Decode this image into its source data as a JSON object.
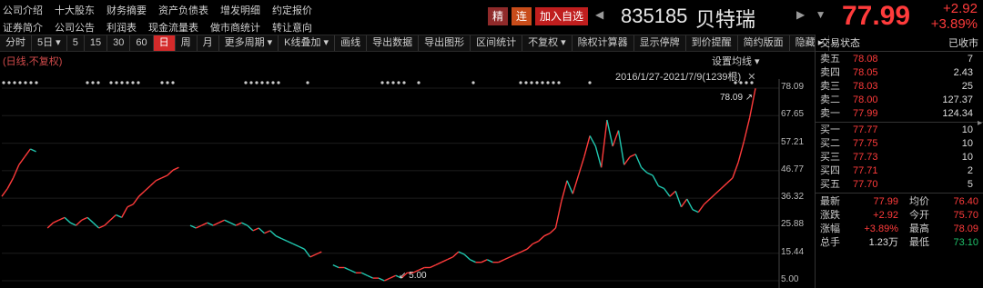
{
  "links": {
    "row1": [
      "公司介绍",
      "十大股东",
      "财务摘要",
      "资产负债表",
      "增发明细",
      "约定报价"
    ],
    "row2": [
      "证券简介",
      "公司公告",
      "利润表",
      "现金流量表",
      "做市商统计",
      "转让意向"
    ]
  },
  "title_bar": {
    "tag_jing": "精",
    "tag_lian": "连",
    "add_watchlist": "加入自选",
    "prev_icon": "◀",
    "code": "835185",
    "name": "贝特瑞",
    "next_icons": "▶ ▼",
    "price": "77.99",
    "change": "+2.92",
    "change_pct": "+3.89%"
  },
  "toolbar": {
    "items": [
      "分时",
      "5日 ▾",
      "5",
      "15",
      "30",
      "60",
      "日",
      "周",
      "月",
      "更多周期 ▾",
      "K线叠加 ▾",
      "画线",
      "导出数据",
      "导出图形",
      "区间统计",
      "不复权 ▾",
      "除权计算器",
      "显示停牌",
      "到价提醒"
    ],
    "active_index": 6,
    "right_items": [
      "简约版面",
      "隐藏 ▸"
    ]
  },
  "chart": {
    "note": "(日线,不复权)",
    "settings": "设置均线 ▾",
    "range": "2016/1/27-2021/7/9(1239根)",
    "close_icon": "✕",
    "max_label": "78.09 ↗",
    "min_label": "↙ 5.00",
    "y_ticks": [
      "78.09",
      "67.65",
      "57.21",
      "46.77",
      "36.32",
      "25.88",
      "15.44",
      "5.00"
    ]
  },
  "chart_data": {
    "type": "line",
    "title": "",
    "xlabel": "",
    "ylabel": "",
    "ylim": [
      5.0,
      78.09
    ],
    "y_ticks": [
      78.09,
      67.65,
      57.21,
      46.77,
      36.32,
      25.88,
      15.44,
      5.0
    ],
    "series": [
      {
        "values": [
          37,
          40,
          44,
          49,
          52,
          55,
          54,
          null,
          25,
          27,
          28,
          29,
          27,
          26,
          28,
          29,
          27,
          25,
          26,
          28,
          30,
          29,
          33,
          34,
          37,
          39,
          41,
          43,
          44,
          45,
          47,
          48,
          null,
          26,
          25,
          26,
          27,
          26,
          27,
          28,
          27,
          26,
          27,
          26,
          24,
          25,
          23,
          24,
          22,
          21,
          20,
          19,
          18,
          17,
          14,
          15,
          16,
          null,
          11,
          10,
          10,
          9,
          8,
          8,
          7,
          6,
          6,
          5,
          6,
          7,
          6,
          8,
          8,
          9,
          10,
          10,
          11,
          12,
          13,
          14,
          16,
          15,
          13,
          12,
          12,
          13,
          12,
          12,
          13,
          14,
          15,
          16,
          17,
          19,
          20,
          22,
          23,
          25,
          35,
          43,
          38,
          45,
          52,
          60,
          56,
          48,
          66,
          56,
          62,
          49,
          52,
          53,
          48,
          46,
          45,
          41,
          40,
          37,
          39,
          33,
          36,
          32,
          31,
          34,
          36,
          38,
          40,
          42,
          44,
          50,
          58,
          67,
          78
        ]
      }
    ],
    "max_point": 78.09,
    "min_point": 5.0,
    "date_range": "2016/1/27-2021/7/9",
    "bars": 1239
  },
  "order_book": {
    "header": "交易状态",
    "status": "已收市",
    "asks": [
      {
        "label": "卖五",
        "price": "78.08",
        "vol": "7"
      },
      {
        "label": "卖四",
        "price": "78.05",
        "vol": "2.43"
      },
      {
        "label": "卖三",
        "price": "78.03",
        "vol": "25"
      },
      {
        "label": "卖二",
        "price": "78.00",
        "vol": "127.37"
      },
      {
        "label": "卖一",
        "price": "77.99",
        "vol": "124.34"
      }
    ],
    "bids": [
      {
        "label": "买一",
        "price": "77.77",
        "vol": "10"
      },
      {
        "label": "买二",
        "price": "77.75",
        "vol": "10"
      },
      {
        "label": "买三",
        "price": "77.73",
        "vol": "10"
      },
      {
        "label": "买四",
        "price": "77.71",
        "vol": "2"
      },
      {
        "label": "买五",
        "price": "77.70",
        "vol": "5"
      }
    ]
  },
  "stats": [
    {
      "k1": "最新",
      "v1": "77.99",
      "k2": "均价",
      "v2": "76.40"
    },
    {
      "k1": "涨跌",
      "v1": "+2.92",
      "k2": "今开",
      "v2": "75.70"
    },
    {
      "k1": "涨幅",
      "v1": "+3.89%",
      "k2": "最高",
      "v2": "78.09"
    },
    {
      "k1": "总手",
      "v1": "1.23万",
      "k2": "最低",
      "v2": "73.10"
    }
  ],
  "colors": {
    "up": "#ff3b3b",
    "down": "#1fc26b",
    "active_tab": "#d42a2a",
    "background": "#000000"
  }
}
